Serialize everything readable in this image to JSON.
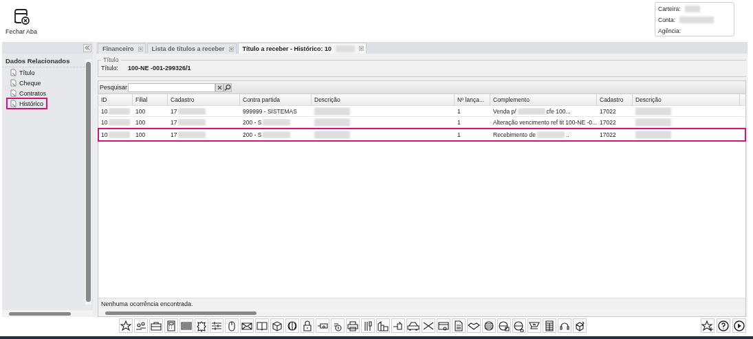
{
  "toolbar": {
    "close_tab": "Fechar Aba"
  },
  "account_info": [
    {
      "label": "Carteira:",
      "value_hidden": true
    },
    {
      "label": "Conta:",
      "value_hidden": true
    },
    {
      "label": "Agência:"
    }
  ],
  "side_panel": {
    "title": "Dados Relacionados",
    "items": [
      {
        "label": "Título",
        "selected": false
      },
      {
        "label": "Cheque",
        "selected": false
      },
      {
        "label": "Contratos",
        "selected": false
      },
      {
        "label": "Histórico",
        "selected": true
      }
    ]
  },
  "tabs": [
    {
      "label": "Financeiro",
      "selected": false
    },
    {
      "label": "Lista de titulos a receber",
      "selected": false
    },
    {
      "label": "Título a receber - Histórico: 10",
      "selected": true,
      "hidden_tail": true
    }
  ],
  "titulo_section": {
    "legend": "Título",
    "label": "Título:",
    "value": "100-NE -001-299326/1"
  },
  "search": {
    "label": "Pesquisar"
  },
  "table": {
    "columns": [
      "ID",
      "Filial",
      "Cadastro",
      "Contra partida",
      "Descrição",
      "Nº lança...",
      "Complemento",
      "Cadastro",
      "Descrição"
    ],
    "rows": [
      {
        "selected": false,
        "cells": [
          {
            "text": "10",
            "blurred": true
          },
          {
            "text": "100"
          },
          {
            "text": "17",
            "blurred": true
          },
          {
            "text": "999999 - SISTEMAS"
          },
          {
            "blurred": true
          },
          {
            "text": "1"
          },
          {
            "text": "Venda p/",
            "blurred": true,
            "tail": "cfe 100..."
          },
          {
            "text": "17022"
          },
          {
            "blurred": true
          }
        ]
      },
      {
        "selected": false,
        "cells": [
          {
            "text": "10",
            "blurred": true
          },
          {
            "text": "100"
          },
          {
            "text": "17",
            "blurred": true
          },
          {
            "text": "200 - S",
            "blurred": true
          },
          {
            "blurred": true
          },
          {
            "text": "1"
          },
          {
            "text": "Alteração vencimento ref tit 100-NE -0..."
          },
          {
            "text": "17022"
          },
          {
            "blurred": true
          }
        ]
      },
      {
        "selected": true,
        "cells": [
          {
            "text": "10",
            "blurred": true
          },
          {
            "text": "100"
          },
          {
            "text": "17",
            "blurred": true
          },
          {
            "text": "200 - S",
            "blurred": true
          },
          {
            "blurred": true
          },
          {
            "text": "1"
          },
          {
            "text": "Recebimento de",
            "blurred": true,
            "tail": ".."
          },
          {
            "text": "17022"
          },
          {
            "blurred": true
          }
        ]
      }
    ]
  },
  "status_text": "Nenhuma ocorrência encontrada."
}
